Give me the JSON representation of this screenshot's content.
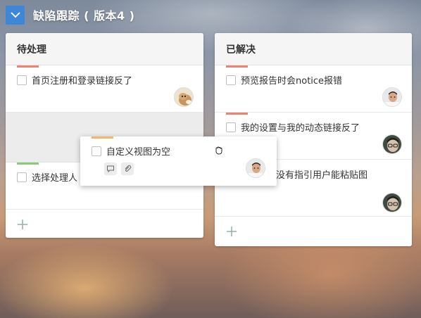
{
  "board": {
    "title": "缺陷跟踪 ( 版本4 )"
  },
  "colors": {
    "accent": "#3d86d8",
    "stripe_red": "#f08070",
    "stripe_orange": "#f5b46e",
    "stripe_green": "#8cc87a"
  },
  "columns": [
    {
      "title": "待处理",
      "cards": [
        {
          "title": "首页注册和登录链接反了",
          "stripe": "red",
          "avatar": "cat-avatar"
        },
        {
          "title": "选择处理人",
          "stripe": "green",
          "avatar": null
        }
      ],
      "add_icon": "plus-icon"
    },
    {
      "title": "已解决",
      "cards": [
        {
          "title": "预览报告时会notice报错",
          "stripe": "red",
          "avatar": "man-avatar"
        },
        {
          "title": "我的设置与我的动态链接反了",
          "stripe": "red",
          "avatar": "glasses-avatar"
        },
        {
          "title": "中没有指引用户能粘贴图",
          "stripe": null,
          "avatar": "glasses-avatar"
        }
      ],
      "add_icon": "plus-icon"
    }
  ],
  "dragging_card": {
    "title": "自定义视图为空",
    "stripe": "orange",
    "icons": [
      "comment-icon",
      "attachment-icon"
    ],
    "avatar": "man-avatar"
  }
}
